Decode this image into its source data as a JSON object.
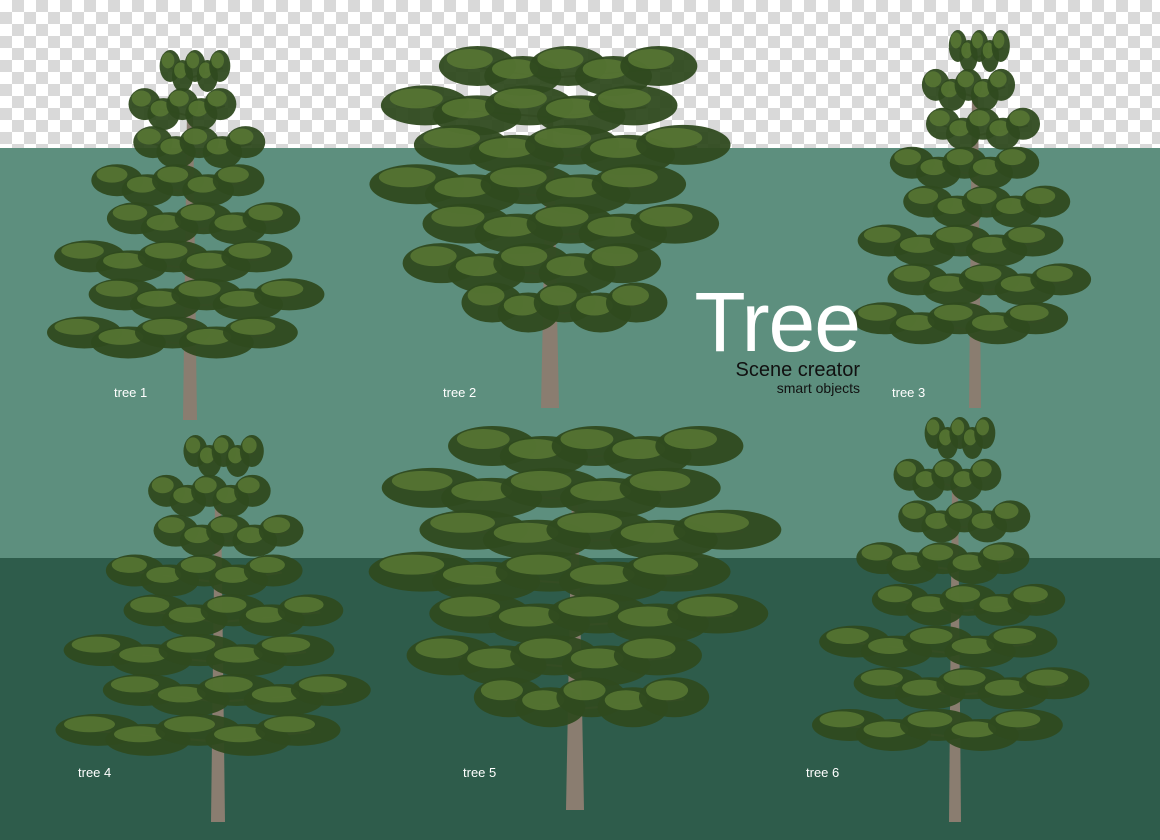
{
  "colors": {
    "mid_band": "#5d8f7e",
    "low_band": "#2e5c4b",
    "foliage_dark": "#2f4a1f",
    "foliage_light": "#5b7a34",
    "trunk": "#8a7d70"
  },
  "title": {
    "main": "Tree",
    "sub": "Scene creator",
    "sub2": "smart objects"
  },
  "trees": [
    {
      "label": "tree 1"
    },
    {
      "label": "tree 2"
    },
    {
      "label": "tree 3"
    },
    {
      "label": "tree 4"
    },
    {
      "label": "tree 5"
    },
    {
      "label": "tree 6"
    }
  ]
}
